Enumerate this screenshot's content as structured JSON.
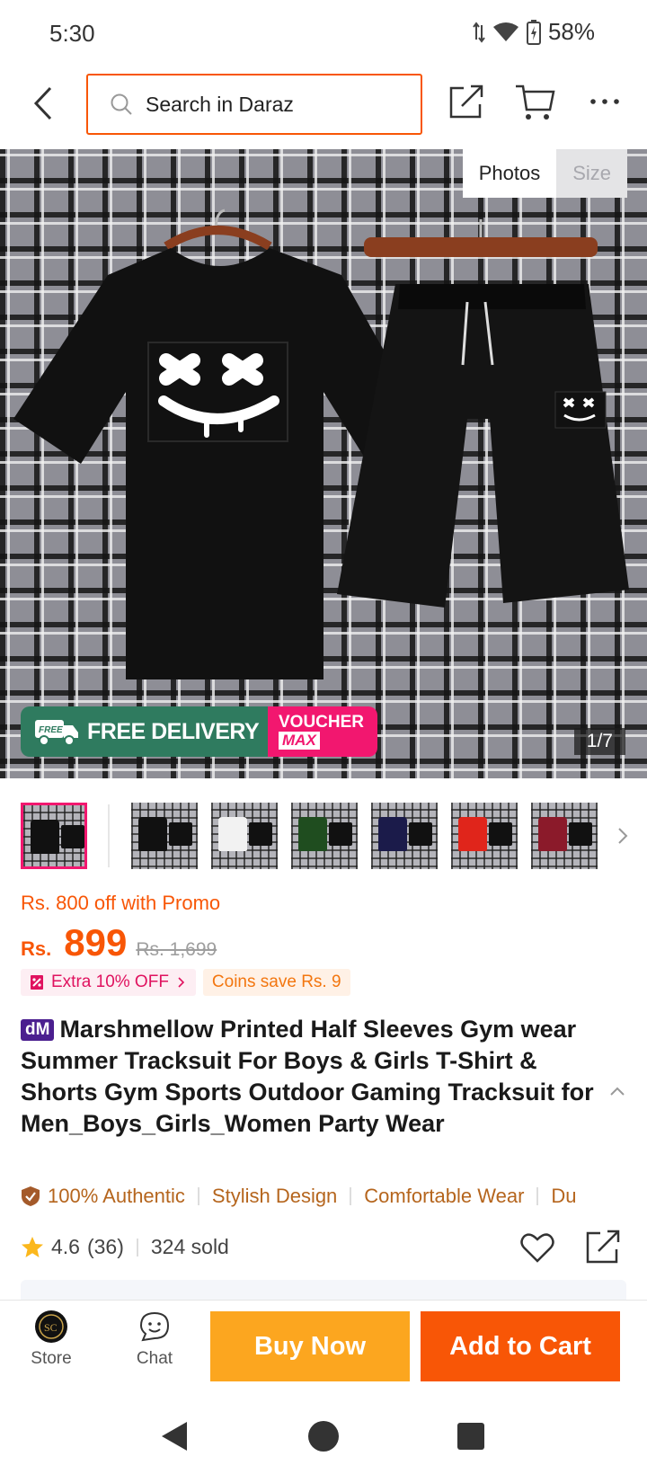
{
  "status_bar": {
    "time": "5:30",
    "battery": "58%"
  },
  "header": {
    "search_placeholder": "Search in Daraz"
  },
  "gallery": {
    "tabs": [
      "Photos",
      "Size"
    ],
    "counter": "1/7",
    "badge_free_delivery": "FREE DELIVERY",
    "badge_free_icon_text": "FREE",
    "badge_voucher_line1": "VOUCHER",
    "badge_voucher_line2": "MAX",
    "thumbnail_colors": [
      "#111111",
      "#111111",
      "#f2f2f2",
      "#1f4d1f",
      "#1b1b4a",
      "#e0251b",
      "#8b1a2a"
    ]
  },
  "pricing": {
    "promo": "Rs. 800 off with Promo",
    "currency": "Rs.",
    "price": "899",
    "original_price": "Rs. 1,699",
    "tag_extra": "Extra 10% OFF",
    "tag_coins": "Coins save Rs. 9"
  },
  "product": {
    "brand_badge": "dM",
    "title": "Marshmellow Printed Half Sleeves Gym wear Summer Tracksuit For Boys & Girls T-Shirt & Shorts Gym Sports Outdoor Gaming Tracksuit for Men_Boys_Girls_Women Party Wear",
    "features": [
      "100% Authentic",
      "Stylish Design",
      "Comfortable Wear",
      "Du"
    ],
    "rating": "4.6",
    "reviews": "(36)",
    "sold": "324 sold"
  },
  "actions": {
    "store": "Store",
    "chat": "Chat",
    "buy_now": "Buy Now",
    "add_to_cart": "Add to Cart",
    "store_logo_text": "SC"
  },
  "colors": {
    "accent": "#f85606",
    "buy_now": "#fca61f",
    "voucher": "#f2176f",
    "free_delivery": "#2f7b5f"
  }
}
